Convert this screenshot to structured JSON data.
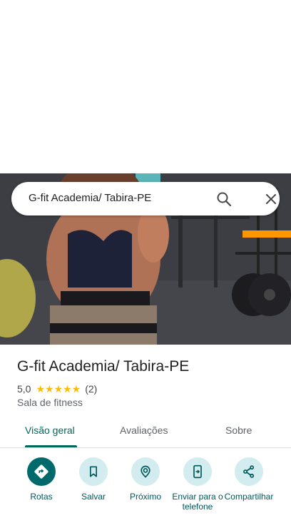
{
  "search": {
    "query": "G-fit Academia/ Tabira-PE"
  },
  "place": {
    "name": "G-fit Academia/ Tabira-PE",
    "rating": "5,0",
    "stars": "★★★★★",
    "review_count": "(2)",
    "category": "Sala de fitness"
  },
  "tabs": [
    {
      "label": "Visão geral",
      "active": true
    },
    {
      "label": "Avaliações",
      "active": false
    },
    {
      "label": "Sobre",
      "active": false
    }
  ],
  "actions": [
    {
      "label": "Rotas",
      "icon": "directions-icon"
    },
    {
      "label": "Salvar",
      "icon": "bookmark-icon"
    },
    {
      "label": "Próximo",
      "icon": "nearby-icon"
    },
    {
      "label": "Enviar para o telefone",
      "icon": "send-to-phone-icon"
    },
    {
      "label": "Compartilhar",
      "icon": "share-icon"
    }
  ],
  "colors": {
    "accent": "#00696b",
    "tab_active": "#00695c",
    "chip_bg": "#d3ecef",
    "star": "#fbbc04"
  }
}
